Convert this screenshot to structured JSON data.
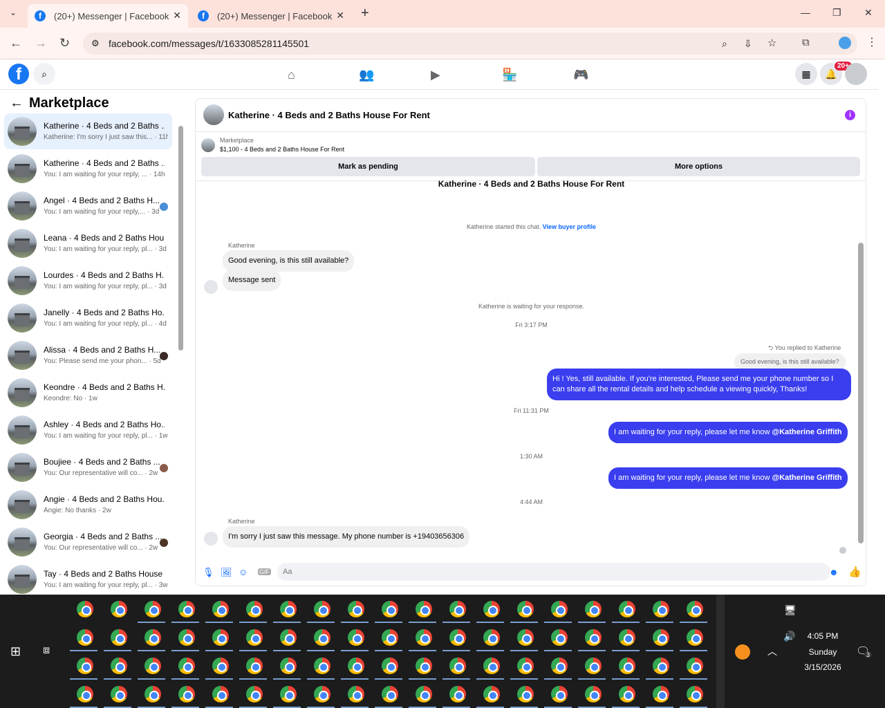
{
  "browser": {
    "tabs": [
      {
        "title": "(20+) Messenger | Facebook"
      },
      {
        "title": "(20+) Messenger | Facebook"
      }
    ],
    "url": "facebook.com/messages/t/1633085281145501",
    "new_tab": "+"
  },
  "fb": {
    "logo": "f",
    "notif_badge": "20+"
  },
  "sidebar": {
    "title": "Marketplace",
    "back": "←",
    "conversations": [
      {
        "name": "Katherine · 4 Beds and 2 Baths ...",
        "sub": "Katherine: I'm sorry I just saw this... · 11h"
      },
      {
        "name": "Katherine · 4 Beds and 2 Baths ...",
        "sub": "You: I am waiting for your reply, ... · 14h"
      },
      {
        "name": "Angel · 4 Beds and 2 Baths H...",
        "sub": "You: I am waiting for your reply,... · 3d"
      },
      {
        "name": "Leana · 4 Beds and 2 Baths Hou...",
        "sub": "You: I am waiting for your reply, pl... · 3d"
      },
      {
        "name": "Lourdes · 4 Beds and 2 Baths H...",
        "sub": "You: I am waiting for your reply, pl... · 3d"
      },
      {
        "name": "Janelly · 4 Beds and 2 Baths Ho...",
        "sub": "You: I am waiting for your reply, pl... · 4d"
      },
      {
        "name": "Alissa · 4 Beds and 2 Baths H...",
        "sub": "You: Please send me your phon... · 5d"
      },
      {
        "name": "Keondre · 4 Beds and 2 Baths H...",
        "sub": "Keondre: No · 1w"
      },
      {
        "name": "Ashley · 4 Beds and 2 Baths Ho...",
        "sub": "You: I am waiting for your reply, pl... · 1w"
      },
      {
        "name": "Boujiee · 4 Beds and 2 Baths ...",
        "sub": "You: Our representative will co... · 2w"
      },
      {
        "name": "Angie · 4 Beds and 2 Baths Hou...",
        "sub": "Angie: No thanks · 2w"
      },
      {
        "name": "Georgia · 4 Beds and 2 Baths ...",
        "sub": "You: Our representative will co... · 2w"
      },
      {
        "name": "Tay · 4 Beds and 2 Baths House ...",
        "sub": "You: I am waiting for your reply, pl... · 3w"
      }
    ]
  },
  "chat": {
    "title": "Katherine · 4 Beds and 2 Baths House For Rent",
    "marketplace_label": "Marketplace",
    "listing": "$1,100 - 4 Beds and 2 Baths House For Rent",
    "mark_pending": "Mark as pending",
    "more_options": "More options",
    "top_partial": "Katherine · 4 Beds and 2 Baths House For Rent",
    "started": "Katherine started this chat.",
    "view_profile": "View buyer profile",
    "sender1": "Katherine",
    "msg1": "Good evening, is this still available?",
    "msg2": "Message sent",
    "waiting": "Katherine is waiting for your response.",
    "time1": "Fri 3:17 PM",
    "replied_to": "You replied to Katherine",
    "quoted": "Good evening, is this still available?",
    "msg3": "Hi ! Yes, still available. If you're interested, Please send me your phone number so I can share all the rental details and help schedule a viewing quickly, Thanks!",
    "time2": "Fri 11:31 PM",
    "msg4": "I am waiting for your reply, please let me know",
    "mention": "@Katherine Griffith",
    "time3": "1:30 AM",
    "msg5": "I am waiting for your reply, please let me know",
    "time4": "4:44 AM",
    "sender2": "Katherine",
    "msg6": "I'm sorry I just saw this message. My phone number is +19403656306",
    "input_placeholder": "Aa"
  },
  "taskbar": {
    "time": "4:05 PM",
    "day": "Sunday",
    "date": "3/15/2026",
    "notif_count": "3"
  }
}
